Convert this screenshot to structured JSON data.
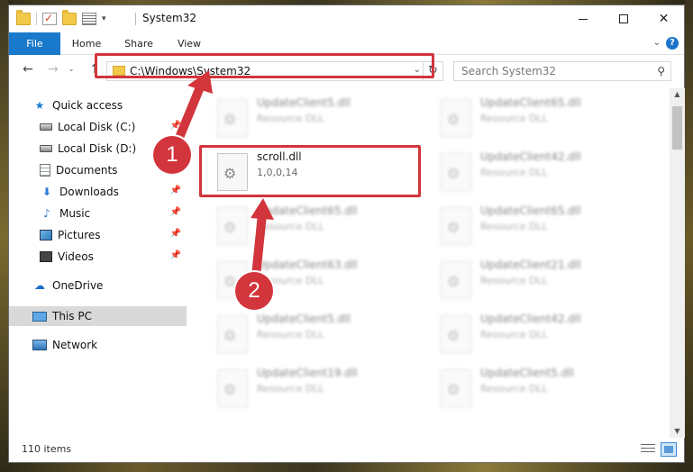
{
  "window": {
    "title": "System32",
    "ribbon_tabs": [
      "File",
      "Home",
      "Share",
      "View"
    ],
    "qat_dropdown": "▾"
  },
  "navigation": {
    "address": "C:\\Windows\\System32",
    "search_placeholder": "Search System32"
  },
  "nav_pane": {
    "items": [
      {
        "label": "Quick access",
        "icon": "star-icon",
        "pinned": false
      },
      {
        "label": "Local Disk (C:)",
        "icon": "disk-icon",
        "pinned": true
      },
      {
        "label": "Local Disk (D:)",
        "icon": "disk-icon",
        "pinned": false
      },
      {
        "label": "Documents",
        "icon": "documents-icon",
        "pinned": true
      },
      {
        "label": "Downloads",
        "icon": "downloads-icon",
        "pinned": true
      },
      {
        "label": "Music",
        "icon": "music-icon",
        "pinned": true
      },
      {
        "label": "Pictures",
        "icon": "pictures-icon",
        "pinned": true
      },
      {
        "label": "Videos",
        "icon": "videos-icon",
        "pinned": true
      },
      {
        "label": "OneDrive",
        "icon": "cloud-icon",
        "pinned": false
      },
      {
        "label": "This PC",
        "icon": "pc-icon",
        "pinned": false,
        "selected": true
      },
      {
        "label": "Network",
        "icon": "network-icon",
        "pinned": false
      }
    ],
    "pin_glyph": "📌"
  },
  "files": {
    "highlighted": {
      "name": "scroll.dll",
      "detail": "1,0,0,14"
    },
    "left_column": [
      {
        "name": "UpdateClient5.dll",
        "detail": "Resource DLL"
      },
      {
        "name": "UpdateClient65.dll",
        "detail": "Resource DLL"
      },
      {
        "name": "UpdateClient63.dll",
        "detail": "Resource DLL"
      },
      {
        "name": "UpdateClient5.dll",
        "detail": "Resource DLL"
      },
      {
        "name": "UpdateClient19.dll",
        "detail": "Resource DLL"
      }
    ],
    "right_column": [
      {
        "name": "UpdateClient65.dll",
        "detail": "Resource DLL"
      },
      {
        "name": "UpdateClient42.dll",
        "detail": "Resource DLL"
      },
      {
        "name": "UpdateClient65.dll",
        "detail": "Resource DLL"
      },
      {
        "name": "UpdateClient21.dll",
        "detail": "Resource DLL"
      },
      {
        "name": "UpdateClient42.dll",
        "detail": "Resource DLL"
      },
      {
        "name": "UpdateClient5.dll",
        "detail": "Resource DLL"
      }
    ]
  },
  "status": {
    "item_count": "110 items"
  },
  "annotations": {
    "marker_1": "1",
    "marker_2": "2",
    "highlight_color": "#d2353c"
  }
}
